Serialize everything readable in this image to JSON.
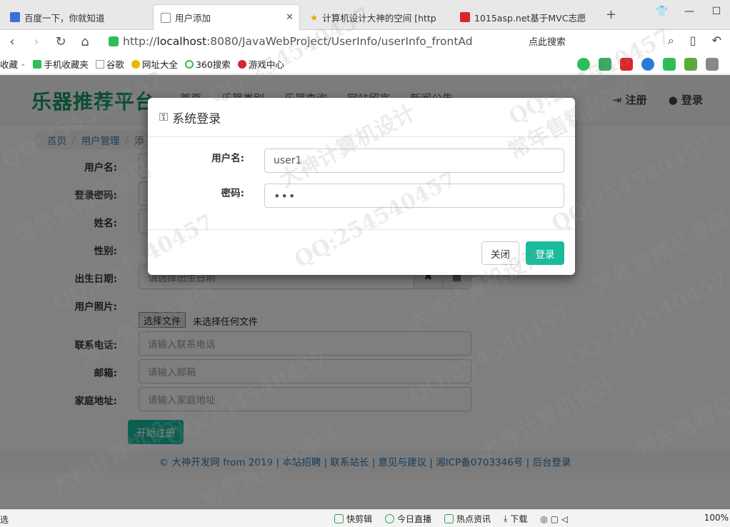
{
  "browser": {
    "tabs": [
      {
        "label": "百度一下，你就知道",
        "active": false,
        "icon": "baidu-paw-icon"
      },
      {
        "label": "用户添加",
        "active": true,
        "icon": "page-icon"
      },
      {
        "label": "计算机设计大神的空间 [http",
        "active": false,
        "icon": "star-icon"
      },
      {
        "label": "1015asp.net基于MVC志愿",
        "active": false,
        "icon": "site-icon"
      }
    ],
    "url_prefix": "http://",
    "url_host": "localhost",
    "url_path": ":8080/JavaWebProject/UserInfo/userInfo_frontAd",
    "search_hint": "点此搜索",
    "bookmarks": [
      "收藏",
      "手机收藏夹",
      "谷歌",
      "网址大全",
      "360搜索",
      "游戏中心"
    ]
  },
  "site": {
    "brand": "乐器推荐平台",
    "nav": [
      "首页",
      "乐器类别",
      "乐器查询",
      "网站留言",
      "新闻公告"
    ],
    "user_links": {
      "register": "注册",
      "login": "登录"
    },
    "breadcrumb": [
      "首页",
      "用户管理",
      "添"
    ],
    "form": {
      "labels": [
        "用户名:",
        "登录密码:",
        "姓名:",
        "性别:",
        "出生日期:",
        "用户照片:",
        "联系电话:",
        "邮箱:",
        "家庭地址:"
      ],
      "birthday_placeholder": "请选择出生日期",
      "phone_placeholder": "请输入联系电话",
      "email_placeholder": "请输入邮箱",
      "address_placeholder": "请输入家庭地址",
      "file_button": "选择文件",
      "file_status": "未选择任何文件",
      "submit": "开始注册"
    },
    "footer": "© 大神开发网 from 2019 | 本站招聘 | 联系站长 | 意见与建议 | 湘ICP备0703346号 | 后台登录"
  },
  "modal": {
    "title": "系统登录",
    "username_label": "用户名:",
    "username_value": "user1",
    "password_label": "密码:",
    "password_value": "•••",
    "close_label": "关闭",
    "login_label": "登录"
  },
  "statusbar": {
    "left": "选",
    "items": [
      "快剪辑",
      "今日直播",
      "热点资讯",
      "下载"
    ],
    "zoom": "100%"
  },
  "watermarks": [
    "QQ:254540457",
    "大神计算机设计",
    "常年售精品源码"
  ],
  "colors": {
    "accent": "#18bc9c",
    "brand": "#169a65",
    "link": "#337ab7"
  }
}
